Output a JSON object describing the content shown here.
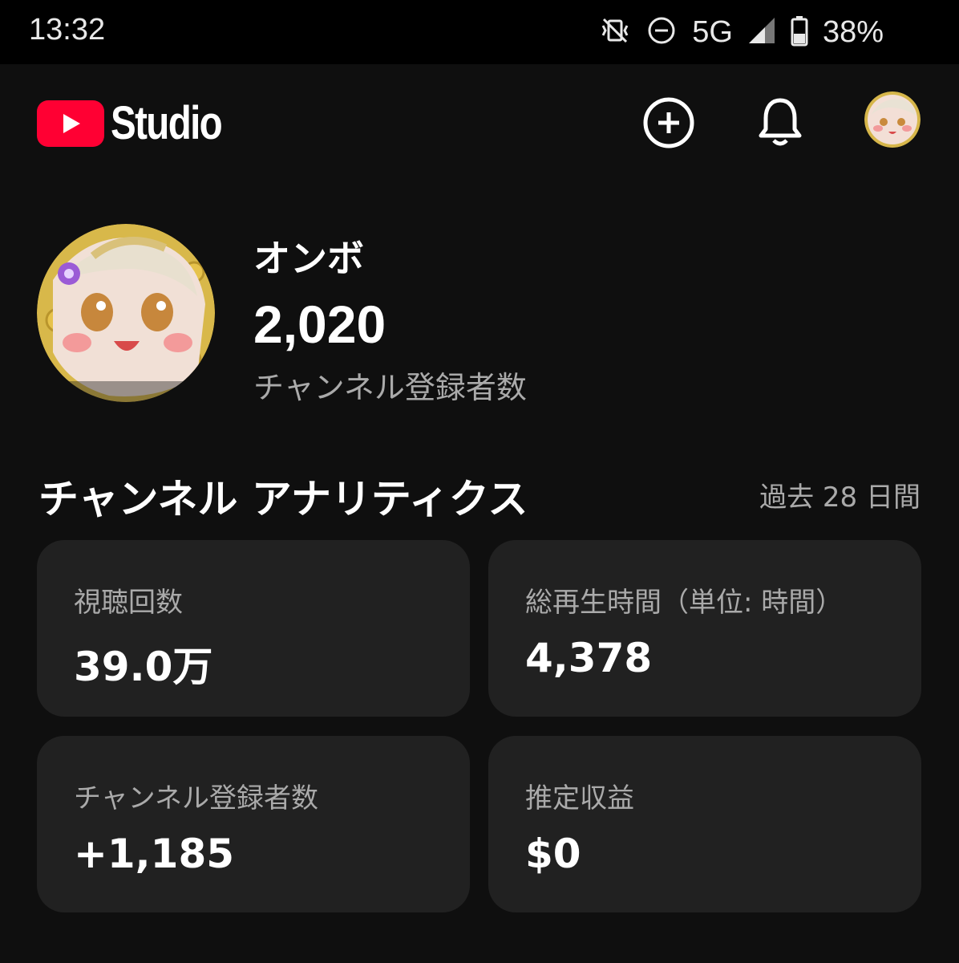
{
  "status_bar": {
    "time": "13:32",
    "network": "5G",
    "battery": "38%",
    "icons": [
      "vibrate-off-icon",
      "do-not-disturb-icon",
      "signal-icon",
      "battery-icon"
    ]
  },
  "header": {
    "logo_text": "Studio",
    "brand_color": "#ff0033",
    "icons": [
      "create-plus-icon",
      "notification-bell-icon"
    ]
  },
  "channel": {
    "name": "オンボ",
    "subscriber_count": "2,020",
    "subscriber_label": "チャンネル登録者数"
  },
  "analytics": {
    "title": "チャンネル アナリティクス",
    "period": "過去 28 日間",
    "cards": [
      {
        "label": "視聴回数",
        "value": "39.0万"
      },
      {
        "label": "総再生時間（単位: 時間）",
        "value": "4,378"
      },
      {
        "label": "チャンネル登録者数",
        "value": "+1,185"
      },
      {
        "label": "推定収益",
        "value": "$0"
      }
    ]
  }
}
